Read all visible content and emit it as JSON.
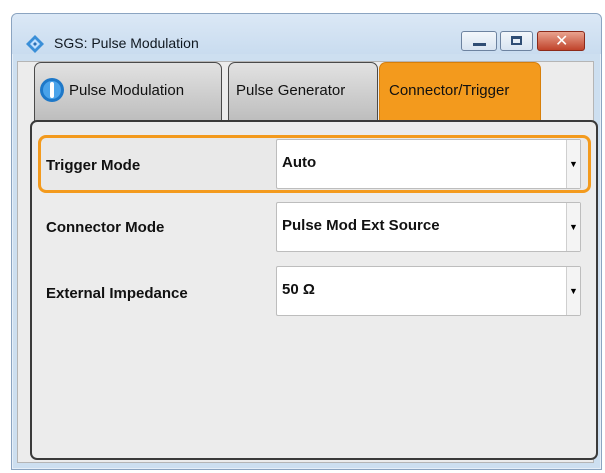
{
  "window": {
    "title": "SGS: Pulse Modulation",
    "controls": {
      "minimize_icon": "minimize-icon",
      "maximize_icon": "maximize-icon",
      "close_icon": "close-icon",
      "close_glyph": "✕"
    },
    "accent_color": "#f39a1d"
  },
  "tabs": [
    {
      "label": "Pulse Modulation",
      "icon": "power-status-icon",
      "active": false
    },
    {
      "label": "Pulse Generator",
      "active": false
    },
    {
      "label": "Connector/Trigger",
      "active": true
    }
  ],
  "fields": [
    {
      "label": "Trigger Mode",
      "value": "Auto",
      "focused": true
    },
    {
      "label": "Connector Mode",
      "value": "Pulse Mod Ext Source",
      "focused": false
    },
    {
      "label": "External Impedance",
      "value": "50 Ω",
      "focused": false
    }
  ],
  "dropdown_arrow": "▼"
}
